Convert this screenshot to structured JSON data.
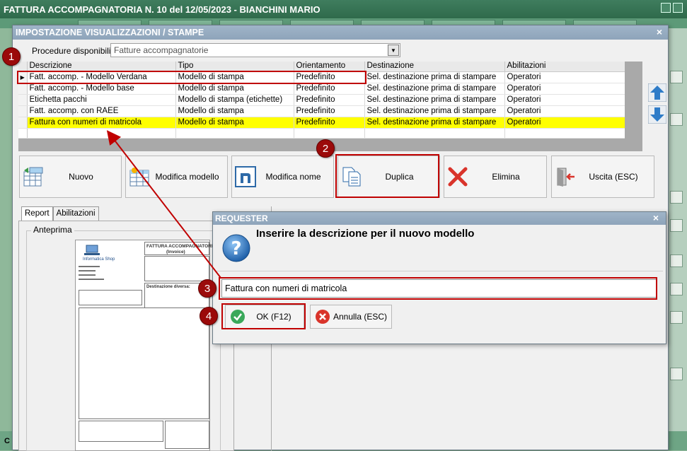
{
  "main_window": {
    "title": "FATTURA ACCOMPAGNATORIA N. 10 del 12/05/2023 - BIANCHINI MARIO",
    "bottom_text": "C"
  },
  "settings_window": {
    "title": "IMPOSTAZIONE VISUALIZZAZIONI / STAMPE",
    "close": "×",
    "procedure_label": "Procedure disponibili :",
    "procedure_value": "Fatture accompagnatorie"
  },
  "grid": {
    "columns": [
      "Descrizione",
      "Tipo",
      "Orientamento",
      "Destinazione",
      "Abilitazioni"
    ],
    "rows": [
      {
        "cells": [
          "Fatt. accomp. - Modello Verdana",
          "Modello di stampa",
          "Predefinito",
          "Sel. destinazione prima di stampare",
          "Operatori"
        ]
      },
      {
        "cells": [
          "Fatt. accomp. - Modello base",
          "Modello di stampa",
          "Predefinito",
          "Sel. destinazione prima di stampare",
          "Operatori"
        ]
      },
      {
        "cells": [
          "Etichetta pacchi",
          "Modello di stampa (etichette)",
          "Predefinito",
          "Sel. destinazione prima di stampare",
          "Operatori"
        ]
      },
      {
        "cells": [
          "Fatt. accomp. con RAEE",
          "Modello di stampa",
          "Predefinito",
          "Sel. destinazione prima di stampare",
          "Operatori"
        ]
      },
      {
        "cells": [
          "Fattura con numeri di matricola",
          "Modello di stampa",
          "Predefinito",
          "Sel. destinazione prima di stampare",
          "Operatori"
        ]
      }
    ]
  },
  "toolbar": {
    "nuovo": "Nuovo",
    "modifica_modello": "Modifica modello",
    "modifica_nome": "Modifica nome",
    "duplica": "Duplica",
    "elimina": "Elimina",
    "uscita": "Uscita (ESC)"
  },
  "tabs": {
    "report": "Report",
    "abilitazioni": "Abilitazioni"
  },
  "preview": {
    "label": "Anteprima",
    "doc_title": "FATTURA ACCOMPAGNATORIA",
    "doc_subtitle": "(Invoice)",
    "company": "Informatica Shop",
    "dest_label": "Destinazione diversa:"
  },
  "requester": {
    "title": "REQUESTER",
    "close": "×",
    "message": "Inserire la descrizione per il nuovo modello",
    "input_value": "Fattura con numeri di matricola",
    "ok": "OK (F12)",
    "annulla": "Annulla (ESC)"
  },
  "annotations": {
    "badges": [
      "1",
      "2",
      "3",
      "4"
    ],
    "color": "#c00000"
  },
  "colors": {
    "title_bar": "#8ea4ba",
    "highlight_row": "#ffff00",
    "main_green": "#2f6a4b"
  }
}
